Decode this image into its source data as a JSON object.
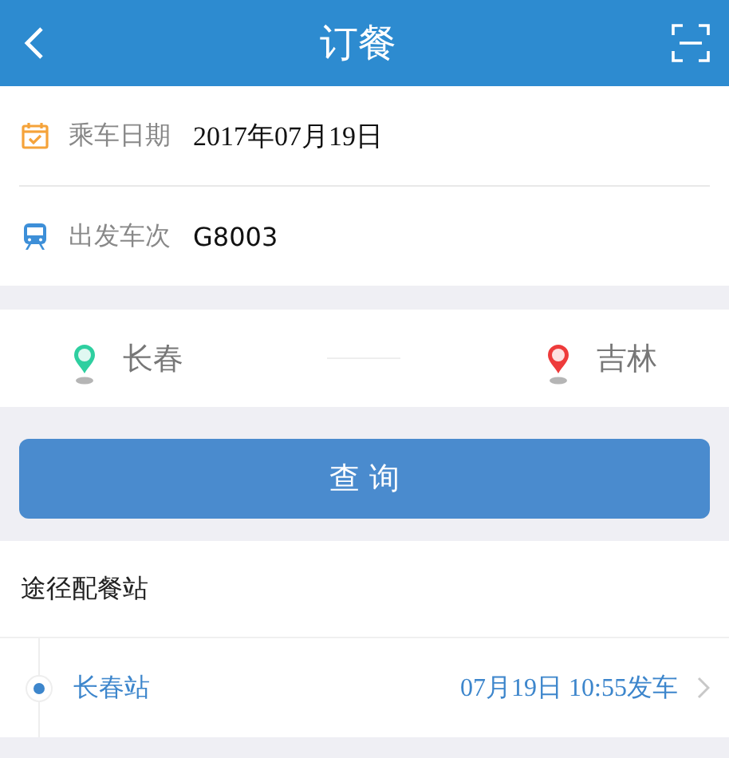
{
  "header": {
    "title": "订餐"
  },
  "fields": [
    {
      "kind": "date",
      "label": "乘车日期",
      "value": "2017年07月19日"
    },
    {
      "kind": "train",
      "label": "出发车次",
      "value": "G8003"
    }
  ],
  "route": {
    "from": "长春",
    "to": "吉林"
  },
  "query_button": "查 询",
  "stations": {
    "title": "途径配餐站",
    "items": [
      {
        "name": "长春站",
        "time": "07月19日 10:55发车",
        "selected": true
      }
    ]
  }
}
